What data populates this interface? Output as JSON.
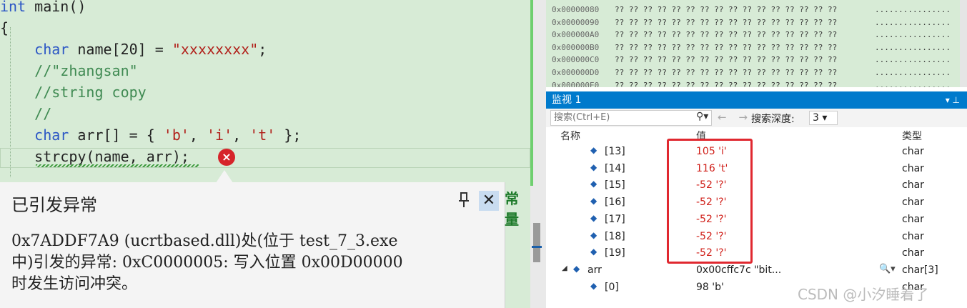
{
  "editor": {
    "lines": [
      {
        "seg": [
          {
            "t": "int",
            "c": "kw"
          },
          {
            "t": " main()",
            "c": "punc"
          }
        ]
      },
      {
        "seg": [
          {
            "t": "{",
            "c": "punc"
          }
        ]
      },
      {
        "seg": [
          {
            "t": "    char",
            "c": "kw"
          },
          {
            "t": " name[20] = ",
            "c": "punc"
          },
          {
            "t": "\"xxxxxxxx\"",
            "c": "str"
          },
          {
            "t": ";",
            "c": "punc"
          }
        ]
      },
      {
        "seg": [
          {
            "t": "    //\"zhangsan\"",
            "c": "cm"
          }
        ]
      },
      {
        "seg": [
          {
            "t": "    //string copy",
            "c": "cm"
          }
        ]
      },
      {
        "seg": [
          {
            "t": "    //",
            "c": "cm"
          }
        ]
      },
      {
        "seg": [
          {
            "t": "    char",
            "c": "kw"
          },
          {
            "t": " arr[] = { ",
            "c": "punc"
          },
          {
            "t": "'b'",
            "c": "str"
          },
          {
            "t": ", ",
            "c": "punc"
          },
          {
            "t": "'i'",
            "c": "str"
          },
          {
            "t": ", ",
            "c": "punc"
          },
          {
            "t": "'t'",
            "c": "str"
          },
          {
            "t": " };",
            "c": "punc"
          }
        ]
      },
      {
        "seg": [
          {
            "t": "    strcpy(name, arr);",
            "c": "punc"
          }
        ]
      }
    ]
  },
  "exception": {
    "title": "已引发异常",
    "message": "0x7ADDF7A9 (ucrtbased.dll)处(位于 test_7_3.exe\n中)引发的异常: 0xC0000005: 写入位置 0x00D00000\n时发生访问冲突。",
    "side_text": "常量",
    "error_icon": "×",
    "pin_icon": "pin-icon",
    "close_glyph": "✕"
  },
  "memory": {
    "rows": [
      {
        "addr": "0x00000080",
        "bytes": "?? ?? ?? ?? ?? ?? ?? ?? ?? ?? ?? ?? ?? ?? ?? ??",
        "ascii": "................"
      },
      {
        "addr": "0x00000090",
        "bytes": "?? ?? ?? ?? ?? ?? ?? ?? ?? ?? ?? ?? ?? ?? ?? ??",
        "ascii": "................"
      },
      {
        "addr": "0x000000A0",
        "bytes": "?? ?? ?? ?? ?? ?? ?? ?? ?? ?? ?? ?? ?? ?? ?? ??",
        "ascii": "................"
      },
      {
        "addr": "0x000000B0",
        "bytes": "?? ?? ?? ?? ?? ?? ?? ?? ?? ?? ?? ?? ?? ?? ?? ??",
        "ascii": "................"
      },
      {
        "addr": "0x000000C0",
        "bytes": "?? ?? ?? ?? ?? ?? ?? ?? ?? ?? ?? ?? ?? ?? ?? ??",
        "ascii": "................"
      },
      {
        "addr": "0x000000D0",
        "bytes": "?? ?? ?? ?? ?? ?? ?? ?? ?? ?? ?? ?? ?? ?? ?? ??",
        "ascii": "................"
      },
      {
        "addr": "0x000000E0",
        "bytes": "?? ?? ?? ?? ?? ?? ?? ?? ?? ?? ?? ?? ?? ?? ?? ??",
        "ascii": "................"
      }
    ]
  },
  "watch": {
    "title": "监视 1",
    "title_controls": "▾ ⊥",
    "search_placeholder": "搜索(Ctrl+E)",
    "search_icon": "⚲▾",
    "nav_arrows": "← →",
    "depth_label": "搜索深度:",
    "depth_value": "3 ▾",
    "col_name": "名称",
    "col_value": "值",
    "col_type": "类型",
    "rows": [
      {
        "name": "[13]",
        "value": "105 'i'",
        "type": "char",
        "red": true
      },
      {
        "name": "[14]",
        "value": "116 't'",
        "type": "char",
        "red": true
      },
      {
        "name": "[15]",
        "value": "-52 '?'",
        "type": "char",
        "red": true
      },
      {
        "name": "[16]",
        "value": "-52 '?'",
        "type": "char",
        "red": true
      },
      {
        "name": "[17]",
        "value": "-52 '?'",
        "type": "char",
        "red": true
      },
      {
        "name": "[18]",
        "value": "-52 '?'",
        "type": "char",
        "red": true
      },
      {
        "name": "[19]",
        "value": "-52 '?'",
        "type": "char",
        "red": true
      },
      {
        "name": "arr",
        "value": "0x00cffc7c \"bit...",
        "type": "char[3]",
        "red": false,
        "expander": "◢",
        "magnifier": "🔍▾"
      },
      {
        "name": "[0]",
        "value": "98 'b'",
        "type": "char",
        "red": false
      }
    ]
  },
  "watermark": "CSDN @小汐睡着了"
}
